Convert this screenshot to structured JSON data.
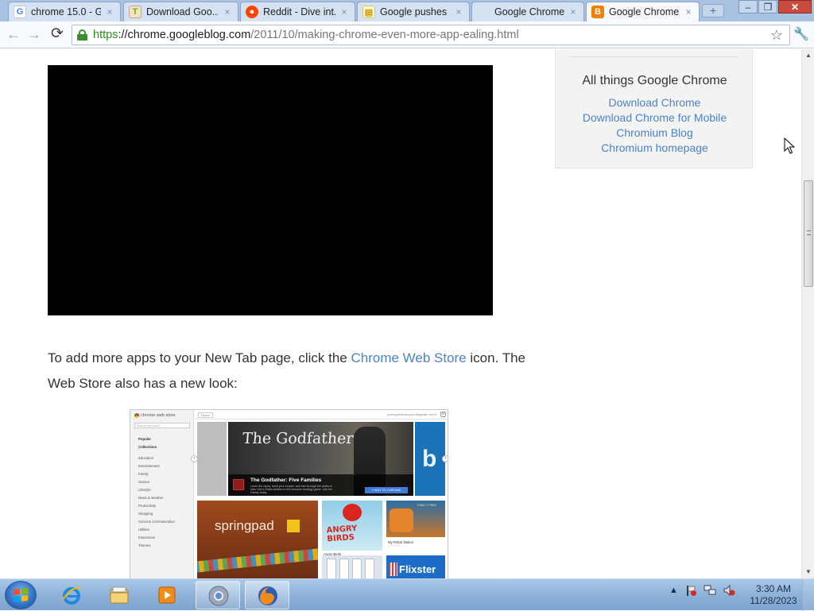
{
  "browser": {
    "tabs": [
      {
        "title": "chrome 15.0 - G...",
        "favicon": "google-g-icon",
        "close": "×"
      },
      {
        "title": "Download Goo...",
        "favicon": "download-page-icon",
        "close": "×"
      },
      {
        "title": "Reddit - Dive int...",
        "favicon": "reddit-icon",
        "close": "×"
      },
      {
        "title": "Google pushes ...",
        "favicon": "document-icon",
        "close": "×"
      },
      {
        "title": "Google Chrome...",
        "favicon": "blank-icon",
        "close": "×"
      },
      {
        "title": "Google Chrome...",
        "favicon": "blogger-icon",
        "close": "×"
      }
    ],
    "new_tab": "+",
    "window_controls": {
      "minimize": "‒",
      "maximize": "❐",
      "close": "✕"
    },
    "url": {
      "scheme": "https",
      "host": "://chrome.googleblog.com",
      "path": "/2011/10/making-chrome-even-more-app-ealing.html"
    },
    "nav": {
      "back": "←",
      "forward": "→",
      "reload": "⟳",
      "star": "☆",
      "wrench": "🔧"
    }
  },
  "page": {
    "body_text_before": "To add more apps to your New Tab page, click the ",
    "link_text": "Chrome Web Store",
    "body_text_after": " icon. The Web Store also has a new look:",
    "sidebar": {
      "heading": "All things Google Chrome",
      "links": [
        "Download Chrome",
        "Download Chrome for Mobile",
        "Chromium Blog",
        "Chromium homepage"
      ]
    },
    "webstore_shot": {
      "logo": "chrome web store",
      "search": "Search the store",
      "home": "Home",
      "account": "yoursignedinaccount@gmail.com ▾",
      "gear": "⚙",
      "nav": [
        "Popular",
        "Collections",
        "Education",
        "Entertainment",
        "Family",
        "Games",
        "Lifestyle",
        "News & weather",
        "Productivity",
        "Shopping",
        "Social & communication",
        "Utilities",
        "Extensions",
        "Themes"
      ],
      "hero_title": "The Godfather",
      "hero_app": "The Godfather: Five Families",
      "hero_desc": "Learn the ropes, build your empire, and rise through the ranks of New York's Mafia families in this browser strategy game. Join the Family today.",
      "hero_button": "+ ADD TO CHROME",
      "right_tile": "b",
      "prev": "‹",
      "next": "›",
      "springpad": "springpad",
      "angry_birds_art": "ANGRY BIRDS",
      "angry_birds": "Angry Birds",
      "angry_birds_rating": "★★★★★",
      "robot_tag": "THINK IT FREE",
      "robot": "My Robot Nation",
      "robot_rating": "☆☆☆☆☆",
      "flixster": "Flixster"
    }
  },
  "scrollbar": {
    "up": "▲",
    "down": "▼",
    "grip": "≡"
  },
  "taskbar": {
    "clock_time": "3:30 AM",
    "clock_date": "11/28/2023",
    "tray_arrow": "▲",
    "apps": [
      "internet-explorer-icon",
      "file-explorer-icon",
      "media-player-icon",
      "chrome-icon",
      "firefox-icon"
    ]
  },
  "colors": {
    "link": "#4a83c9",
    "url_scheme": "#2e8b21",
    "lock": "#3a8f2c"
  }
}
